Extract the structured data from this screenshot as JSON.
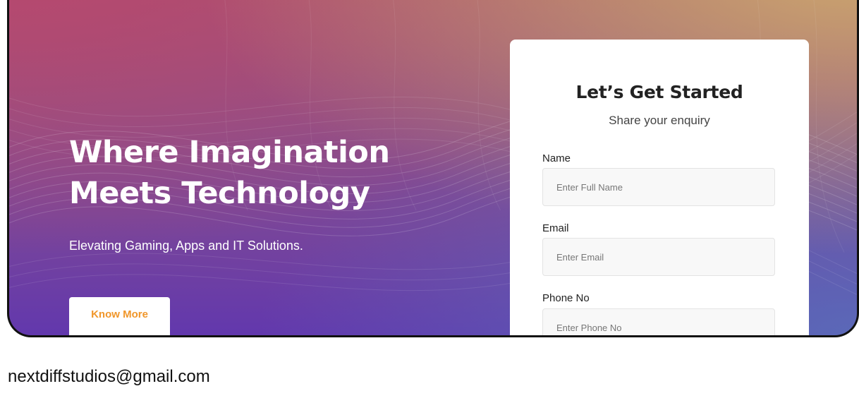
{
  "hero": {
    "title_line1": "Where Imagination",
    "title_line2": "Meets Technology",
    "subtitle": "Elevating Gaming, Apps and IT Solutions.",
    "cta_label": "Know More"
  },
  "form": {
    "title": "Let’s Get Started",
    "subtitle": "Share your enquiry",
    "fields": [
      {
        "label": "Name",
        "placeholder": "Enter Full Name",
        "value": ""
      },
      {
        "label": "Email",
        "placeholder": "Enter Email",
        "value": ""
      },
      {
        "label": "Phone No",
        "placeholder": "Enter Phone No",
        "value": ""
      }
    ]
  },
  "footer": {
    "email": "nextdiffstudios@gmail.com"
  },
  "colors": {
    "accent": "#f0962a",
    "gradient_top_left": "#b9466e",
    "gradient_top_right": "#cdaa6e",
    "gradient_bottom": "#6238ad"
  }
}
